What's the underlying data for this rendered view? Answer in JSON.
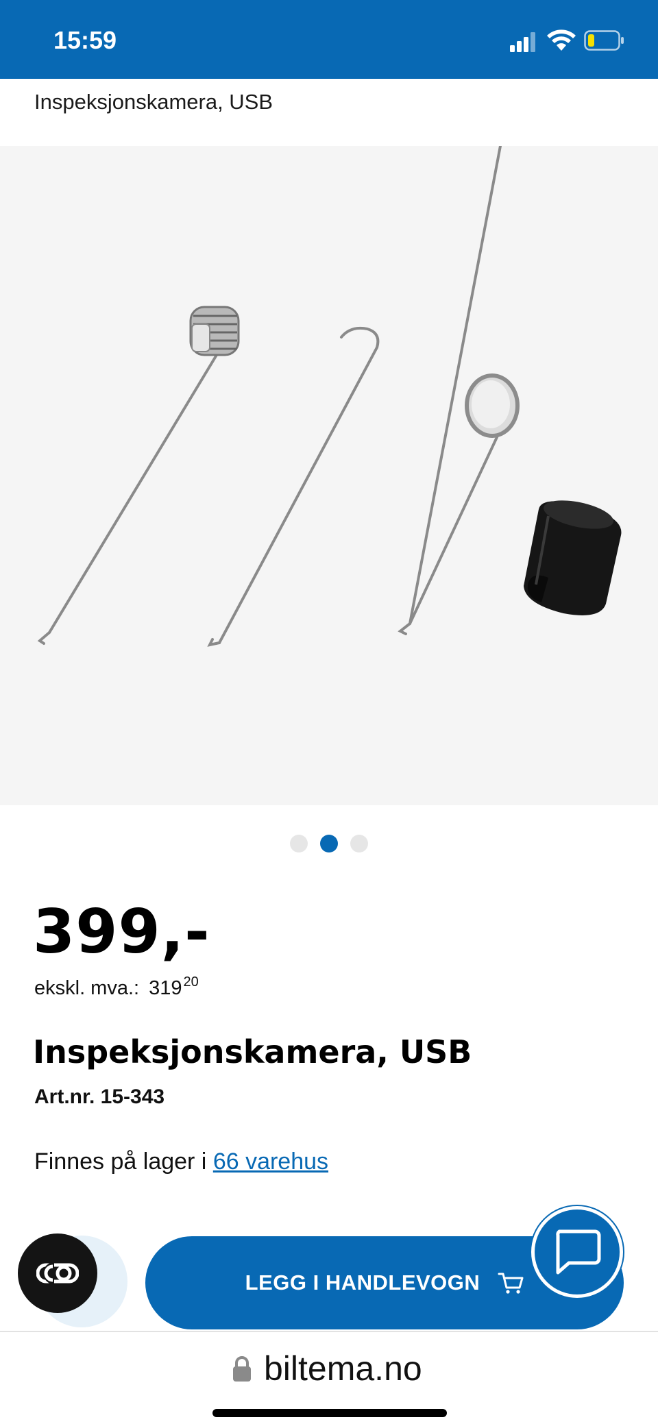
{
  "status_bar": {
    "time": "15:59",
    "icons": [
      "signal-icon",
      "wifi-icon",
      "battery-icon"
    ],
    "background_color": "#0869b4",
    "battery_level_color": "#f5e000"
  },
  "header": {
    "breadcrumb_title": "Inspeksjonskamera, USB"
  },
  "gallery": {
    "image_count": 3,
    "active_index": 1,
    "content": "inspection camera accessories: magnet hook, hook, mirror, adapter sleeve"
  },
  "product": {
    "price": "399,-",
    "vat_label": "ekskl. mva.:",
    "vat_price_main": "319",
    "vat_price_cents": "20",
    "name": "Inspeksjonskamera, USB",
    "article_number": "Art.nr. 15-343",
    "stock_prefix": "Finnes på lager i ",
    "stock_link": "66 varehus"
  },
  "actions": {
    "add_to_cart_label": "LEGG I HANDLEVOGN",
    "cookie_icon": "cookie-settings-icon",
    "chat_icon": "chat-icon",
    "cart_icon": "cart-icon",
    "accent_color": "#0869b4"
  },
  "browser": {
    "domain": "biltema.no",
    "lock_icon": "lock-icon"
  }
}
